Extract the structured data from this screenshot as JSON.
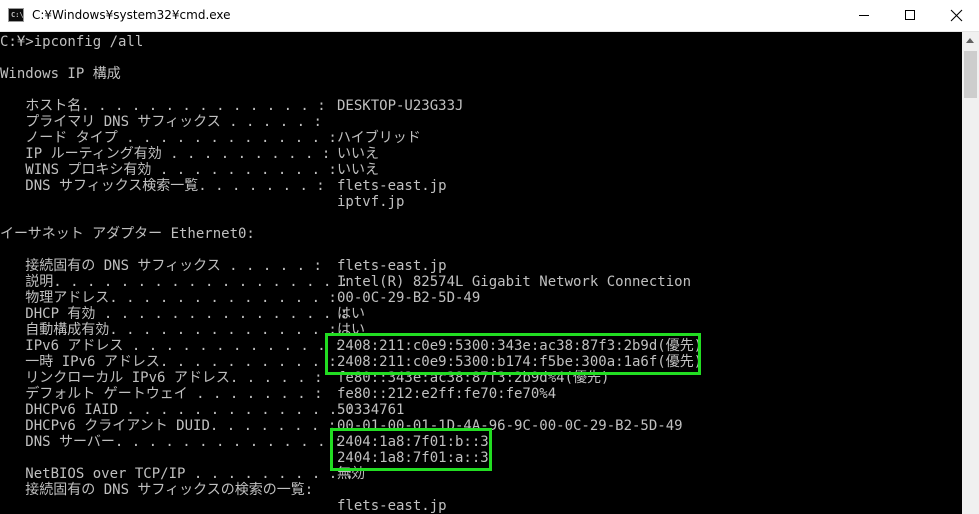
{
  "window": {
    "title": "C:¥Windows¥system32¥cmd.exe",
    "icon": "cmd-app-icon",
    "icon_text": "C:\\"
  },
  "console": {
    "prompt_line": "C:¥>ipconfig /all",
    "windows_ip_header": "Windows IP 構成",
    "host_section": [
      {
        "label": "   ホスト名. . . . . . . . . . . . . . :",
        "value": "DESKTOP-U23G33J"
      },
      {
        "label": "   プライマリ DNS サフィックス . . . . . :",
        "value": ""
      },
      {
        "label": "   ノード タイプ . . . . . . . . . . . . :",
        "value": "ハイブリッド"
      },
      {
        "label": "   IP ルーティング有効 . . . . . . . . . :",
        "value": "いいえ"
      },
      {
        "label": "   WINS プロキシ有効 . . . . . . . . . . :",
        "value": "いいえ"
      },
      {
        "label": "   DNS サフィックス検索一覧. . . . . . . :",
        "value": "flets-east.jp"
      },
      {
        "label": "",
        "value": "iptvf.jp"
      }
    ],
    "adapter_header": "イーサネット アダプター Ethernet0:",
    "adapter_section": [
      {
        "label": "   接続固有の DNS サフィックス . . . . . :",
        "value": "flets-east.jp"
      },
      {
        "label": "   説明. . . . . . . . . . . . . . . . . :",
        "value": "Intel(R) 82574L Gigabit Network Connection"
      },
      {
        "label": "   物理アドレス. . . . . . . . . . . . . :",
        "value": "00-0C-29-B2-5D-49"
      },
      {
        "label": "   DHCP 有効 . . . . . . . . . . . . . . :",
        "value": "はい"
      },
      {
        "label": "   自動構成有効. . . . . . . . . . . . . :",
        "value": "はい"
      },
      {
        "label": "   IPv6 アドレス . . . . . . . . . . . . :",
        "value": "2408:211:c0e9:5300:343e:ac38:87f3:2b9d(優先)"
      },
      {
        "label": "   一時 IPv6 アドレス. . . . . . . . . . :",
        "value": "2408:211:c0e9:5300:b174:f5be:300a:1a6f(優先)"
      },
      {
        "label": "   リンクローカル IPv6 アドレス. . . . . :",
        "value": "fe80::343e:ac38:87f3:2b9d%4(優先)"
      },
      {
        "label": "   デフォルト ゲートウェイ . . . . . . . :",
        "value": "fe80::212:e2ff:fe70:fe70%4"
      },
      {
        "label": "   DHCPv6 IAID . . . . . . . . . . . . . :",
        "value": "50334761"
      },
      {
        "label": "   DHCPv6 クライアント DUID. . . . . . . :",
        "value": "00-01-00-01-1D-4A-96-9C-00-0C-29-B2-5D-49"
      },
      {
        "label": "   DNS サーバー. . . . . . . . . . . . . :",
        "value": "2404:1a8:7f01:b::3"
      },
      {
        "label": "",
        "value": "2404:1a8:7f01:a::3"
      },
      {
        "label": "   NetBIOS over TCP/IP . . . . . . . . . :",
        "value": "無効"
      },
      {
        "label": "   接続固有の DNS サフィックスの検索の一覧:",
        "value": ""
      },
      {
        "label": "",
        "value": "flets-east.jp"
      }
    ]
  },
  "highlight": {
    "color": "#22dd22",
    "boxes": [
      "ipv6-addresses",
      "dns-servers"
    ]
  }
}
